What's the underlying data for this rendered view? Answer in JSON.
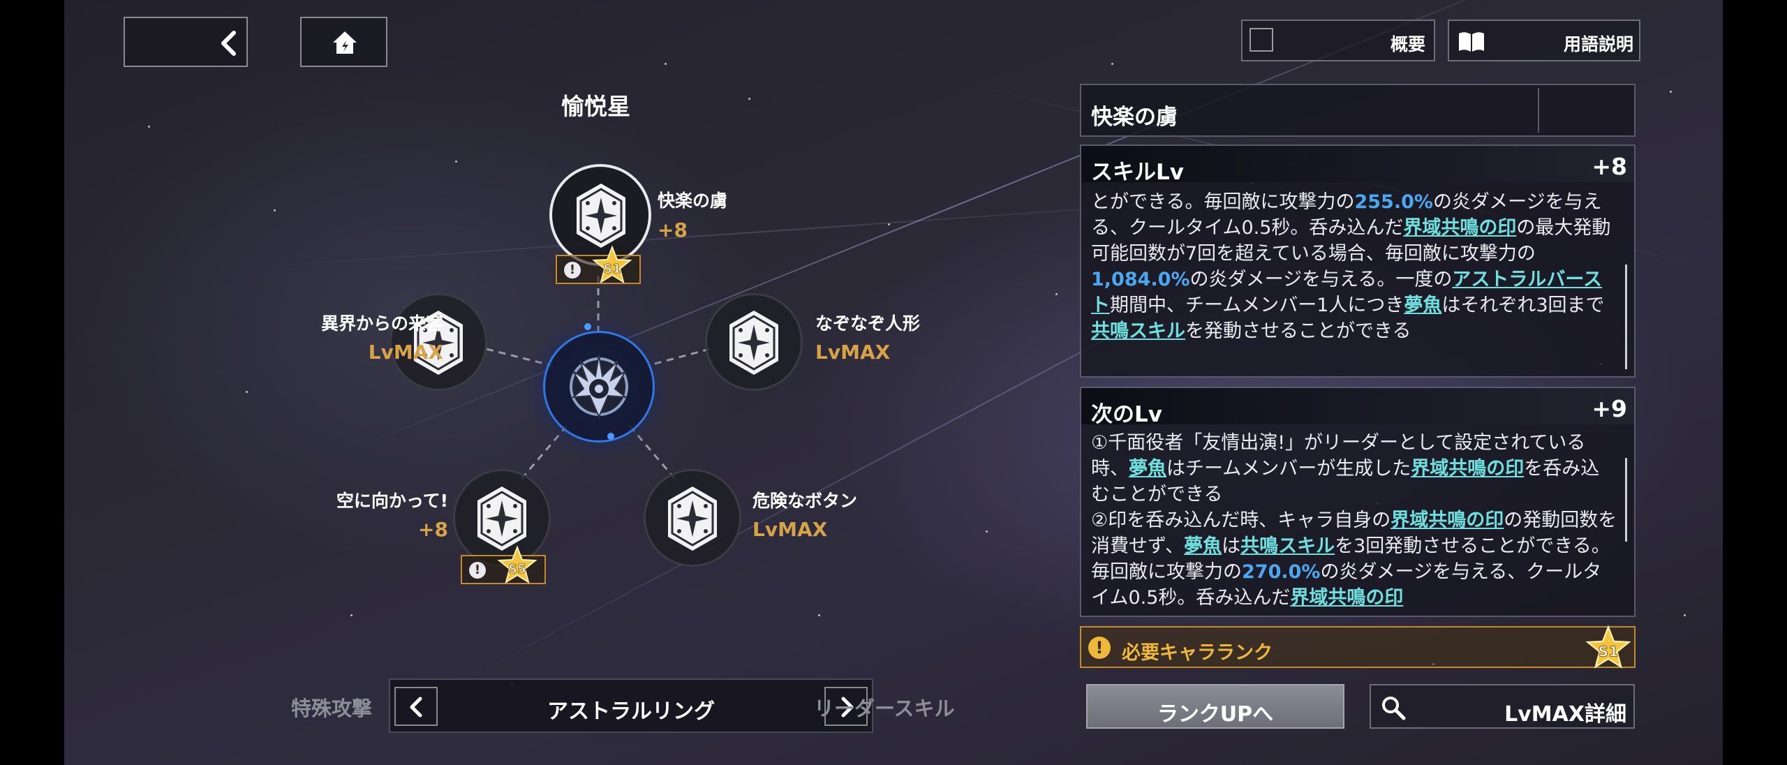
{
  "header": {
    "overview_label": "概要",
    "glossary_label": "用語説明"
  },
  "constellation": {
    "title": "愉悦星",
    "nodes": [
      {
        "name": "快楽の虜",
        "level": "+8",
        "rank": "S1"
      },
      {
        "name": "異界からの来客",
        "level": "LvMAX"
      },
      {
        "name": "なぞなぞ人形",
        "level": "LvMAX"
      },
      {
        "name": "空に向かって!",
        "level": "+8",
        "rank": "S5"
      },
      {
        "name": "危険なボタン",
        "level": "LvMAX"
      }
    ]
  },
  "bottom_nav": {
    "left_label": "特殊攻撃",
    "current": "アストラルリング",
    "right_label": "リーダースキル"
  },
  "detail": {
    "title": "快楽の虜",
    "skill": {
      "heading": "スキルLv",
      "level": "+8",
      "parts": [
        {
          "t": "とができる。毎回敵に攻撃力の"
        },
        {
          "t": "255.0%",
          "c": "hl"
        },
        {
          "t": "の炎ダメージを与える、クールタイム0.5秒。呑み込んだ"
        },
        {
          "t": "界域共鳴の印",
          "c": "lk"
        },
        {
          "t": "の最大発動可能回数が7回を超えている場合、毎回敵に攻撃力の"
        },
        {
          "t": "1,084.0%",
          "c": "hl"
        },
        {
          "t": "の炎ダメージを与える。一度の"
        },
        {
          "t": "アストラルバースト",
          "c": "lk"
        },
        {
          "t": "期間中、チームメンバー1人につき"
        },
        {
          "t": "夢魚",
          "c": "lk"
        },
        {
          "t": "はそれぞれ3回まで"
        },
        {
          "t": "共鳴スキル",
          "c": "lk"
        },
        {
          "t": "を発動させることができる"
        }
      ]
    },
    "next": {
      "heading": "次のLv",
      "level": "+9",
      "parts": [
        {
          "t": "①千面役者「友情出演!」がリーダーとして設定されている時、"
        },
        {
          "t": "夢魚",
          "c": "lk"
        },
        {
          "t": "はチームメンバーが生成した"
        },
        {
          "t": "界域共鳴の印",
          "c": "lk"
        },
        {
          "t": "を呑み込むことができる"
        },
        {
          "br": true
        },
        {
          "t": "②印を呑み込んだ時、キャラ自身の"
        },
        {
          "t": "界域共鳴の印",
          "c": "lk"
        },
        {
          "t": "の発動回数を消費せず、"
        },
        {
          "t": "夢魚",
          "c": "lk"
        },
        {
          "t": "は"
        },
        {
          "t": "共鳴スキル",
          "c": "lk"
        },
        {
          "t": "を3回発動させることができる。毎回敵に攻撃力の"
        },
        {
          "t": "270.0%",
          "c": "hl"
        },
        {
          "t": "の炎ダメージを与える、クールタイム0.5秒。呑み込んだ"
        },
        {
          "t": "界域共鳴の印",
          "c": "lk"
        }
      ]
    },
    "requirement": {
      "label": "必要キャラランク",
      "rank": "S1"
    },
    "rank_up_button": "ランクUPへ",
    "lvmax_button": "LvMAX詳細"
  },
  "colors": {
    "accent_gold": "#d6a348",
    "highlight_blue": "#4aa8f0",
    "link_cyan": "#6fe0e0"
  },
  "icons": [
    "back-arrow-icon",
    "home-icon",
    "checkbox-icon",
    "book-icon",
    "search-icon",
    "warning-icon",
    "star-rank-icon",
    "chevron-left-icon",
    "chevron-right-icon"
  ]
}
